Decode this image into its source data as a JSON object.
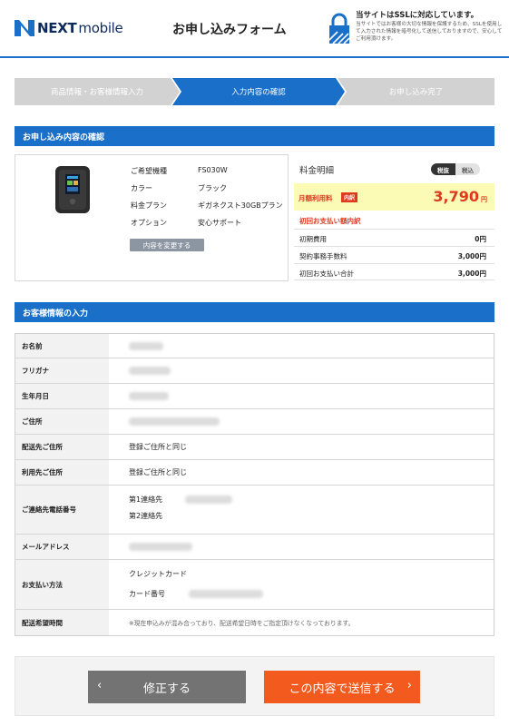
{
  "header": {
    "logo_text_a": "NEXT",
    "logo_text_b": "mobile",
    "form_title": "お申し込みフォーム",
    "ssl_title": "当サイトはSSLに対応しています。",
    "ssl_desc": "当サイトではお客様の大切な情報を保護するため、SSLを使用して入力された情報を暗号化して送信しておりますので、安心してご利用頂けます。"
  },
  "steps": [
    {
      "label": "商品情報・お客様情報入力"
    },
    {
      "label": "入力内容の確認"
    },
    {
      "label": "お申し込み完了"
    }
  ],
  "confirm_section": {
    "title": "お申し込み内容の確認",
    "specs": [
      {
        "key": "ご希望機種",
        "value": "FS030W"
      },
      {
        "key": "カラー",
        "value": "ブラック"
      },
      {
        "key": "料金プラン",
        "value": "ギガネクスト30GBプラン"
      },
      {
        "key": "オプション",
        "value": "安心サポート"
      }
    ],
    "change_button": "内容を変更する"
  },
  "price": {
    "title": "料金明細",
    "tax_excluded": "税抜",
    "tax_included": "税込",
    "monthly_label": "月額利用料",
    "monthly_badge": "内訳",
    "monthly_amount": "3,790",
    "yen": "円",
    "first_label": "初回お支払い額内訳",
    "fees": [
      {
        "key": "初期費用",
        "value": "0円"
      },
      {
        "key": "契約事務手数料",
        "value": "3,000円"
      },
      {
        "key": "初回お支払い合計",
        "value": "3,000円"
      }
    ]
  },
  "customer_section": {
    "title": "お客様情報の入力",
    "rows": [
      {
        "key": "お名前"
      },
      {
        "key": "フリガナ"
      },
      {
        "key": "生年月日"
      },
      {
        "key": "ご住所"
      },
      {
        "key": "配送先ご住所",
        "value": "登録ご住所と同じ"
      },
      {
        "key": "利用先ご住所",
        "value": "登録ご住所と同じ"
      },
      {
        "key": "ご連絡先電話番号",
        "value": "第1連絡先",
        "value2": "第2連絡先"
      },
      {
        "key": "メールアドレス"
      },
      {
        "key": "お支払い方法",
        "value": "クレジットカード",
        "value2": "カード番号"
      },
      {
        "key": "配送希望時間",
        "value": "※現在申込みが混み合っており、配送希望日時をご指定頂けなくなっております。"
      }
    ]
  },
  "buttons": {
    "back": "修正する",
    "send": "この内容で送信する"
  },
  "colors": {
    "brand_blue": "#1a6fc9",
    "accent_orange": "#f25a1e",
    "price_red": "#e03a1e"
  }
}
